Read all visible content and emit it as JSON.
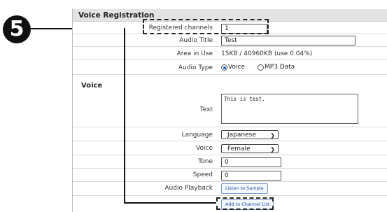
{
  "step": {
    "number": "5"
  },
  "header": {
    "title": "Voice Registration"
  },
  "form": {
    "registered_channels": {
      "label": "Registered channels",
      "value": "1"
    },
    "audio_title": {
      "label": "Audio Title",
      "value": "Test"
    },
    "area_in_use": {
      "label": "Area in Use",
      "value": "15KB / 40960KB (use 0.04%)"
    },
    "audio_type": {
      "label": "Audio Type",
      "options": [
        "Voice",
        "MP3 Data"
      ],
      "selected": "Voice"
    }
  },
  "voice_section": {
    "title": "Voice",
    "text": {
      "label": "Text",
      "value": "This is test."
    },
    "language": {
      "label": "Language",
      "value": "Japanese"
    },
    "voice": {
      "label": "Voice",
      "value": "Female"
    },
    "tone": {
      "label": "Tone",
      "value": "0"
    },
    "speed": {
      "label": "Speed",
      "value": "0"
    },
    "audio_playback": {
      "label": "Audio Playback",
      "button": "Listen to Sample"
    },
    "add_button": "Add to Channel List"
  },
  "colors": {
    "accent": "#1f5fbf",
    "header_bg": "#e3e3e3",
    "button_text": "#1d4ea6"
  }
}
